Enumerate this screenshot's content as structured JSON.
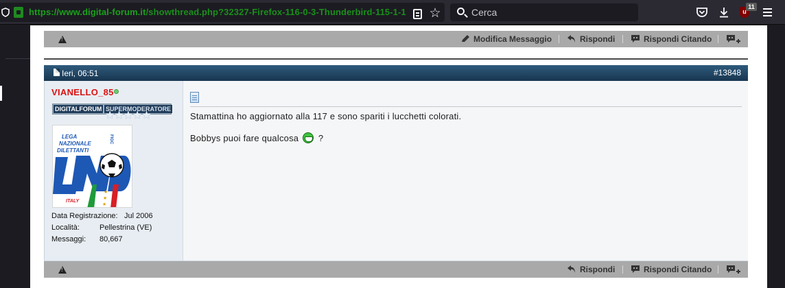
{
  "browser": {
    "url_domain": "https://www.digital-forum.it",
    "url_path": "/showthread.php?32327-Firefox-116-0-3-Thunderbird-115-1-1",
    "search_placeholder": "Cerca",
    "ublock_count": "11",
    "ublock_label": "u"
  },
  "actions": {
    "edit": "Modifica Messaggio",
    "reply": "Rispondi",
    "quote": "Rispondi Citando"
  },
  "post": {
    "date": "Ieri, 06:51",
    "number": "#13848",
    "username": "VIANELLO_85",
    "rank_left": "DIGITALFORUM",
    "rank_right": "SUPERMODERATORE",
    "stars": "★★★★★",
    "avatar_text": {
      "line1": "LEGA",
      "line2": "NAZIONALE",
      "line3": "DILETTANTI",
      "country": "ITALY",
      "side": "FIGC"
    },
    "info": [
      {
        "label": "Data Registrazione:",
        "value": "Jul 2006"
      },
      {
        "label": "Località:",
        "value": "Pellestrina (VE)"
      },
      {
        "label": "Messaggi:",
        "value": "80,667"
      }
    ],
    "message_line1": "Stamattina ho aggiornato alla 117 e sono spariti i lucchetti colorati.",
    "message_line2a": "Bobbys puoi fare qualcosa",
    "message_line2b": "?"
  },
  "colors": {
    "url_green": "#1aa11a",
    "username_red": "#dd1111",
    "header_blue": "#1f4566",
    "action_bar_gray": "#a9a9a9"
  }
}
